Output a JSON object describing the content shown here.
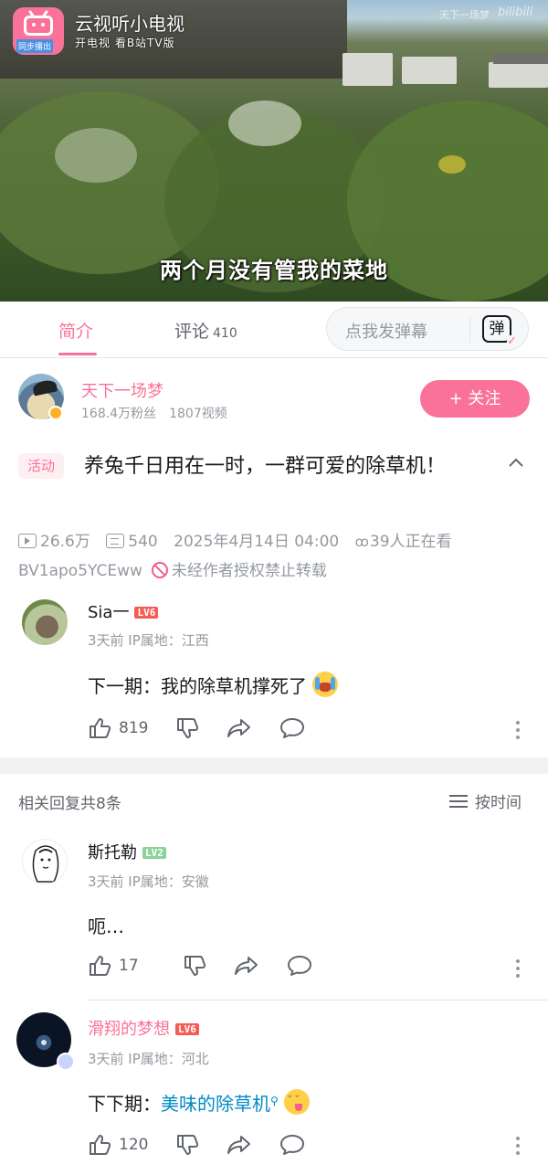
{
  "video": {
    "subtitle": "两个月没有管我的菜地",
    "app_name": "云视听小电视",
    "app_tagline": "开电视 看B站TV版",
    "sync_label": "同步播出",
    "watermark_text": "天下一场梦",
    "watermark_logo": "bilibili"
  },
  "tabs": {
    "intro_label": "简介",
    "comments_label": "评论",
    "comments_count": "410",
    "danmaku_placeholder": "点我发弹幕",
    "danmaku_icon_glyph": "弹"
  },
  "uploader": {
    "name": "天下一场梦",
    "followers": "168.4万粉丝",
    "videos": "1807视频",
    "follow_label": "+ 关注"
  },
  "video_info": {
    "activity_tag": "活动",
    "title": "养兔千日用在一时，一群可爱的除草机！",
    "views": "26.6万",
    "danmaku_count": "540",
    "published": "2025年4月14日 04:00",
    "watching": "39人正在看",
    "bvid": "BV1apo5YCEww",
    "repost_notice": "未经作者授权禁止转载"
  },
  "main_comment": {
    "user": "Sia一",
    "level": "LV6",
    "meta": "3天前 IP属地：江西",
    "text": "下一期：我的除草机撑死了",
    "likes": "819"
  },
  "replies_header": {
    "label": "相关回复共8条",
    "sort_label": "按时间"
  },
  "replies": [
    {
      "user": "斯托勒",
      "level": "LV2",
      "meta": "3天前 IP属地：安徽",
      "text": "呃…",
      "likes": "17"
    },
    {
      "user": "滑翔的梦想",
      "level": "LV6",
      "meta": "3天前 IP属地：河北",
      "text_prefix": "下下期：",
      "text_link": "美味的除草机",
      "likes": "120"
    }
  ],
  "colors": {
    "brand_pink": "#fb7299",
    "link_blue": "#008ac5",
    "text_gray": "#9499a0",
    "lv6": "#f85a54",
    "lv2": "#8bd29b"
  }
}
